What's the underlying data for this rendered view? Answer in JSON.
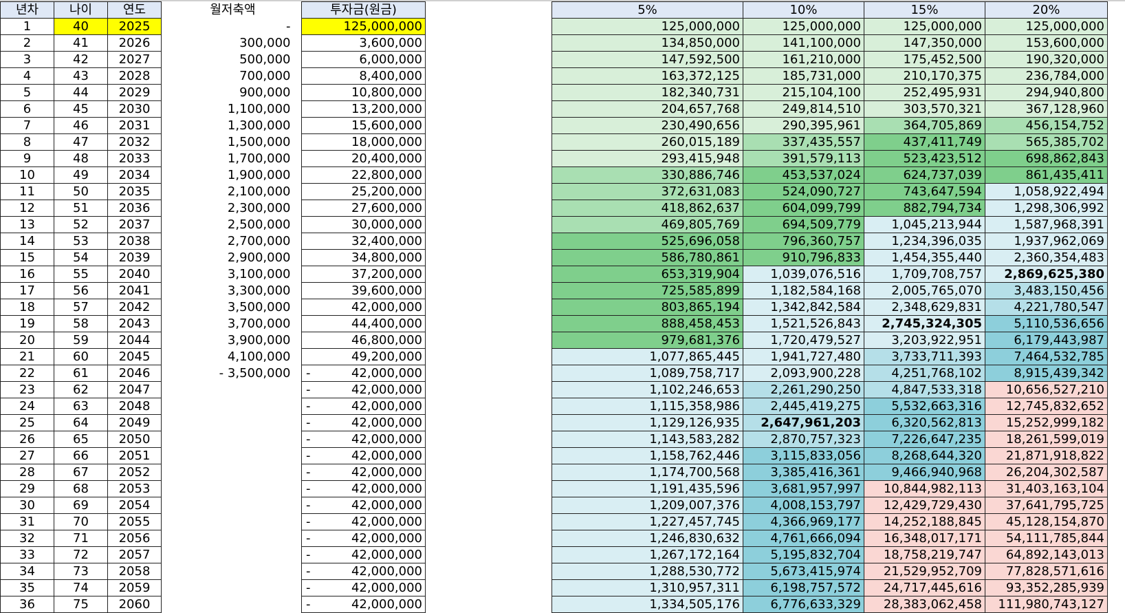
{
  "left_headers": [
    "년차",
    "나이",
    "연도",
    "월저축액",
    "투자금(원금)"
  ],
  "rows": [
    {
      "n": "1",
      "age": "40",
      "year": "2025",
      "sav": "-",
      "inv": "125,000,000",
      "dash": ""
    },
    {
      "n": "2",
      "age": "41",
      "year": "2026",
      "sav": "300,000",
      "inv": "3,600,000",
      "dash": ""
    },
    {
      "n": "3",
      "age": "42",
      "year": "2027",
      "sav": "500,000",
      "inv": "6,000,000",
      "dash": ""
    },
    {
      "n": "4",
      "age": "43",
      "year": "2028",
      "sav": "700,000",
      "inv": "8,400,000",
      "dash": ""
    },
    {
      "n": "5",
      "age": "44",
      "year": "2029",
      "sav": "900,000",
      "inv": "10,800,000",
      "dash": ""
    },
    {
      "n": "6",
      "age": "45",
      "year": "2030",
      "sav": "1,100,000",
      "inv": "13,200,000",
      "dash": ""
    },
    {
      "n": "7",
      "age": "46",
      "year": "2031",
      "sav": "1,300,000",
      "inv": "15,600,000",
      "dash": ""
    },
    {
      "n": "8",
      "age": "47",
      "year": "2032",
      "sav": "1,500,000",
      "inv": "18,000,000",
      "dash": ""
    },
    {
      "n": "9",
      "age": "48",
      "year": "2033",
      "sav": "1,700,000",
      "inv": "20,400,000",
      "dash": ""
    },
    {
      "n": "10",
      "age": "49",
      "year": "2034",
      "sav": "1,900,000",
      "inv": "22,800,000",
      "dash": ""
    },
    {
      "n": "11",
      "age": "50",
      "year": "2035",
      "sav": "2,100,000",
      "inv": "25,200,000",
      "dash": ""
    },
    {
      "n": "12",
      "age": "51",
      "year": "2036",
      "sav": "2,300,000",
      "inv": "27,600,000",
      "dash": ""
    },
    {
      "n": "13",
      "age": "52",
      "year": "2037",
      "sav": "2,500,000",
      "inv": "30,000,000",
      "dash": ""
    },
    {
      "n": "14",
      "age": "53",
      "year": "2038",
      "sav": "2,700,000",
      "inv": "32,400,000",
      "dash": ""
    },
    {
      "n": "15",
      "age": "54",
      "year": "2039",
      "sav": "2,900,000",
      "inv": "34,800,000",
      "dash": ""
    },
    {
      "n": "16",
      "age": "55",
      "year": "2040",
      "sav": "3,100,000",
      "inv": "37,200,000",
      "dash": ""
    },
    {
      "n": "17",
      "age": "56",
      "year": "2041",
      "sav": "3,300,000",
      "inv": "39,600,000",
      "dash": ""
    },
    {
      "n": "18",
      "age": "57",
      "year": "2042",
      "sav": "3,500,000",
      "inv": "42,000,000",
      "dash": ""
    },
    {
      "n": "19",
      "age": "58",
      "year": "2043",
      "sav": "3,700,000",
      "inv": "44,400,000",
      "dash": ""
    },
    {
      "n": "20",
      "age": "59",
      "year": "2044",
      "sav": "3,900,000",
      "inv": "46,800,000",
      "dash": ""
    },
    {
      "n": "21",
      "age": "60",
      "year": "2045",
      "sav": "4,100,000",
      "inv": "49,200,000",
      "dash": ""
    },
    {
      "n": "22",
      "age": "61",
      "year": "2046",
      "sav": "- 3,500,000",
      "inv": "42,000,000",
      "dash": "-"
    },
    {
      "n": "23",
      "age": "62",
      "year": "2047",
      "sav": "",
      "inv": "42,000,000",
      "dash": "-"
    },
    {
      "n": "24",
      "age": "63",
      "year": "2048",
      "sav": "",
      "inv": "42,000,000",
      "dash": "-"
    },
    {
      "n": "25",
      "age": "64",
      "year": "2049",
      "sav": "",
      "inv": "42,000,000",
      "dash": "-"
    },
    {
      "n": "26",
      "age": "65",
      "year": "2050",
      "sav": "",
      "inv": "42,000,000",
      "dash": "-"
    },
    {
      "n": "27",
      "age": "66",
      "year": "2051",
      "sav": "",
      "inv": "42,000,000",
      "dash": "-"
    },
    {
      "n": "28",
      "age": "67",
      "year": "2052",
      "sav": "",
      "inv": "42,000,000",
      "dash": "-"
    },
    {
      "n": "29",
      "age": "68",
      "year": "2053",
      "sav": "",
      "inv": "42,000,000",
      "dash": "-"
    },
    {
      "n": "30",
      "age": "69",
      "year": "2054",
      "sav": "",
      "inv": "42,000,000",
      "dash": "-"
    },
    {
      "n": "31",
      "age": "70",
      "year": "2055",
      "sav": "",
      "inv": "42,000,000",
      "dash": "-"
    },
    {
      "n": "32",
      "age": "71",
      "year": "2056",
      "sav": "",
      "inv": "42,000,000",
      "dash": "-"
    },
    {
      "n": "33",
      "age": "72",
      "year": "2057",
      "sav": "",
      "inv": "42,000,000",
      "dash": "-"
    },
    {
      "n": "34",
      "age": "73",
      "year": "2058",
      "sav": "",
      "inv": "42,000,000",
      "dash": "-"
    },
    {
      "n": "35",
      "age": "74",
      "year": "2059",
      "sav": "",
      "inv": "42,000,000",
      "dash": "-"
    },
    {
      "n": "36",
      "age": "75",
      "year": "2060",
      "sav": "",
      "inv": "42,000,000",
      "dash": "-"
    }
  ],
  "right_headers": [
    "5%",
    "10%",
    "15%",
    "20%"
  ],
  "growth": [
    [
      "125,000,000",
      "125,000,000",
      "125,000,000",
      "125,000,000"
    ],
    [
      "134,850,000",
      "141,100,000",
      "147,350,000",
      "153,600,000"
    ],
    [
      "147,592,500",
      "161,210,000",
      "175,452,500",
      "190,320,000"
    ],
    [
      "163,372,125",
      "185,731,000",
      "210,170,375",
      "236,784,000"
    ],
    [
      "182,340,731",
      "215,104,100",
      "252,495,931",
      "294,940,800"
    ],
    [
      "204,657,768",
      "249,814,510",
      "303,570,321",
      "367,128,960"
    ],
    [
      "230,490,656",
      "290,395,961",
      "364,705,869",
      "456,154,752"
    ],
    [
      "260,015,189",
      "337,435,557",
      "437,411,749",
      "565,385,702"
    ],
    [
      "293,415,948",
      "391,579,113",
      "523,423,512",
      "698,862,843"
    ],
    [
      "330,886,746",
      "453,537,024",
      "624,737,039",
      "861,435,411"
    ],
    [
      "372,631,083",
      "524,090,727",
      "743,647,594",
      "1,058,922,494"
    ],
    [
      "418,862,637",
      "604,099,799",
      "882,794,734",
      "1,298,306,992"
    ],
    [
      "469,805,769",
      "694,509,779",
      "1,045,213,944",
      "1,587,968,391"
    ],
    [
      "525,696,058",
      "796,360,757",
      "1,234,396,035",
      "1,937,962,069"
    ],
    [
      "586,780,861",
      "910,796,833",
      "1,454,355,440",
      "2,360,354,483"
    ],
    [
      "653,319,904",
      "1,039,076,516",
      "1,709,708,757",
      "2,869,625,380"
    ],
    [
      "725,585,899",
      "1,182,584,168",
      "2,005,765,070",
      "3,483,150,456"
    ],
    [
      "803,865,194",
      "1,342,842,584",
      "2,348,629,831",
      "4,221,780,547"
    ],
    [
      "888,458,453",
      "1,521,526,843",
      "2,745,324,305",
      "5,110,536,656"
    ],
    [
      "979,681,376",
      "1,720,479,527",
      "3,203,922,951",
      "6,179,443,987"
    ],
    [
      "1,077,865,445",
      "1,941,727,480",
      "3,733,711,393",
      "7,464,532,785"
    ],
    [
      "1,089,758,717",
      "2,093,900,228",
      "4,251,768,102",
      "8,915,439,342"
    ],
    [
      "1,102,246,653",
      "2,261,290,250",
      "4,847,533,318",
      "10,656,527,210"
    ],
    [
      "1,115,358,986",
      "2,445,419,275",
      "5,532,663,316",
      "12,745,832,652"
    ],
    [
      "1,129,126,935",
      "2,647,961,203",
      "6,320,562,813",
      "15,252,999,182"
    ],
    [
      "1,143,583,282",
      "2,870,757,323",
      "7,226,647,235",
      "18,261,599,019"
    ],
    [
      "1,158,762,446",
      "3,115,833,056",
      "8,268,644,320",
      "21,871,918,822"
    ],
    [
      "1,174,700,568",
      "3,385,416,361",
      "9,466,940,968",
      "26,204,302,587"
    ],
    [
      "1,191,435,596",
      "3,681,957,997",
      "10,844,982,113",
      "31,403,163,104"
    ],
    [
      "1,209,007,376",
      "4,008,153,797",
      "12,429,729,430",
      "37,641,795,725"
    ],
    [
      "1,227,457,745",
      "4,366,969,177",
      "14,252,188,845",
      "45,128,154,870"
    ],
    [
      "1,246,830,632",
      "4,761,666,094",
      "16,348,017,171",
      "54,111,785,844"
    ],
    [
      "1,267,172,164",
      "5,195,832,704",
      "18,758,219,747",
      "64,892,143,013"
    ],
    [
      "1,288,530,772",
      "5,673,415,974",
      "21,529,952,709",
      "77,828,571,616"
    ],
    [
      "1,310,957,311",
      "6,198,757,572",
      "24,717,445,616",
      "93,352,285,939"
    ],
    [
      "1,334,505,176",
      "6,776,633,329",
      "28,383,062,458",
      "111,980,743,127"
    ]
  ],
  "bold_cells": [
    [
      15,
      3
    ],
    [
      18,
      2
    ],
    [
      24,
      1
    ]
  ],
  "colors": {
    "yellow": "#ffff00",
    "header": "#dfe8f6",
    "green_light": "#d8efd9",
    "green_mid": "#a9dfb2",
    "green_dark": "#7fcf8c",
    "cyan_light": "#d9eef3",
    "cyan_mid": "#b5dfe8",
    "cyan_dark": "#8dcfdb",
    "pink": "#fad7d3"
  }
}
